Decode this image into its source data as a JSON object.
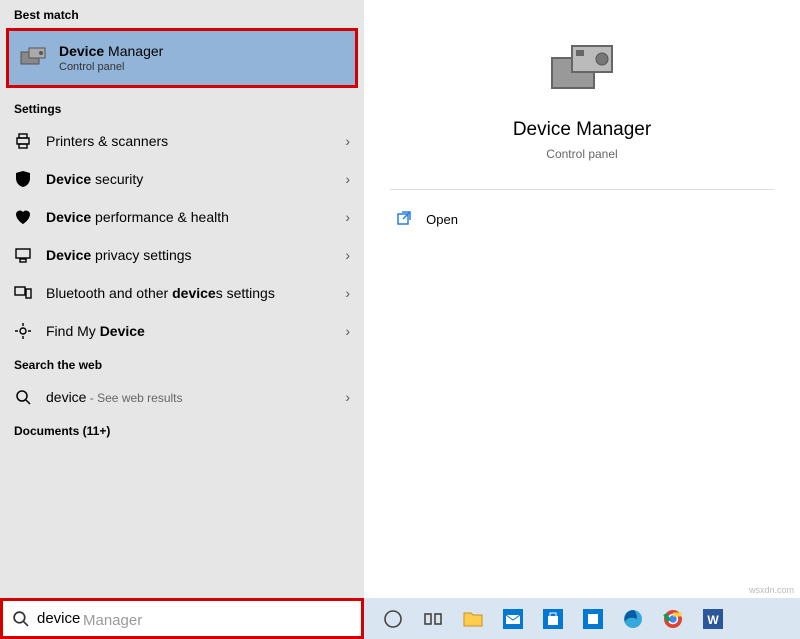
{
  "sections": {
    "best_match": "Best match",
    "settings": "Settings",
    "search_web": "Search the web",
    "documents": "Documents (11+)"
  },
  "best_match_item": {
    "title_bold": "Device",
    "title_rest": " Manager",
    "subtitle": "Control panel"
  },
  "settings_items": [
    {
      "label_pre": "",
      "label_bold": "",
      "label_post": "Printers & scanners"
    },
    {
      "label_pre": "",
      "label_bold": "Device",
      "label_post": " security"
    },
    {
      "label_pre": "",
      "label_bold": "Device",
      "label_post": " performance & health"
    },
    {
      "label_pre": "",
      "label_bold": "Device",
      "label_post": " privacy settings"
    },
    {
      "label_pre": "Bluetooth and other ",
      "label_bold": "device",
      "label_post": "s settings"
    },
    {
      "label_pre": "Find My ",
      "label_bold": "Device",
      "label_post": ""
    }
  ],
  "web_item": {
    "term": "device",
    "suffix": " - See web results"
  },
  "hero": {
    "title": "Device Manager",
    "subtitle": "Control panel"
  },
  "actions": {
    "open": "Open"
  },
  "search": {
    "typed": "device",
    "ghost": " Manager"
  },
  "watermark": "wsxdn.com"
}
